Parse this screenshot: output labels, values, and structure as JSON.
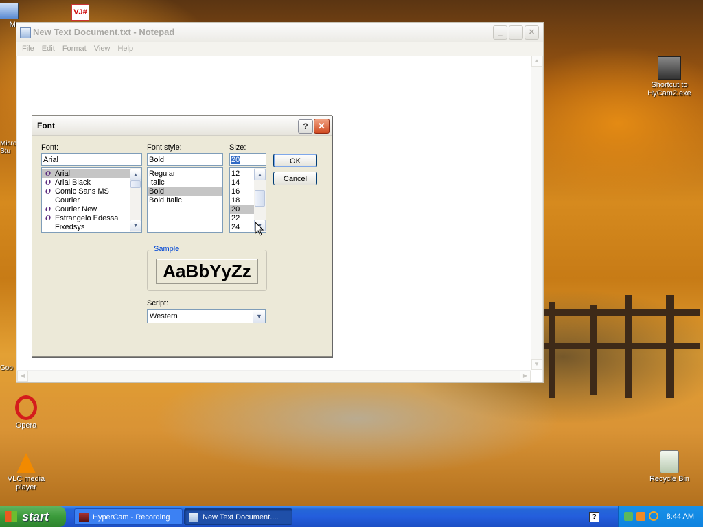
{
  "notepad": {
    "title": "New Text Document.txt - Notepad",
    "menu": [
      "File",
      "Edit",
      "Format",
      "View",
      "Help"
    ]
  },
  "dialog": {
    "title": "Font",
    "help_label": "?",
    "font_label": "Font:",
    "font_value": "Arial",
    "fonts": [
      "Arial",
      "Arial Black",
      "Comic Sans MS",
      "Courier",
      "Courier New",
      "Estrangelo Edessa",
      "Fixedsys"
    ],
    "style_label": "Font style:",
    "style_value": "Bold",
    "styles": [
      "Regular",
      "Italic",
      "Bold",
      "Bold Italic"
    ],
    "size_label": "Size:",
    "size_value": "20",
    "sizes": [
      "12",
      "14",
      "16",
      "18",
      "20",
      "22",
      "24"
    ],
    "ok_label": "OK",
    "cancel_label": "Cancel",
    "sample_label": "Sample",
    "sample_text": "AaBbYyZz",
    "script_label": "Script:",
    "script_value": "Western"
  },
  "desktop_icons": {
    "hycam": "Shortcut to HyCam2.exe",
    "opera": "Opera",
    "vlc": "VLC media player",
    "recycle": "Recycle Bin",
    "my": "My",
    "micro": "Micro Stu",
    "google": "Goo"
  },
  "taskbar": {
    "start_label": "start",
    "items": [
      "HyperCam - Recording",
      "New Text Document...."
    ],
    "clock": "8:44 AM"
  },
  "colors": {
    "taskbar": "#245edc",
    "start_button": "#3a9a3a",
    "dialog_bg": "#ece9d8",
    "selection": "#c5c5c5"
  }
}
